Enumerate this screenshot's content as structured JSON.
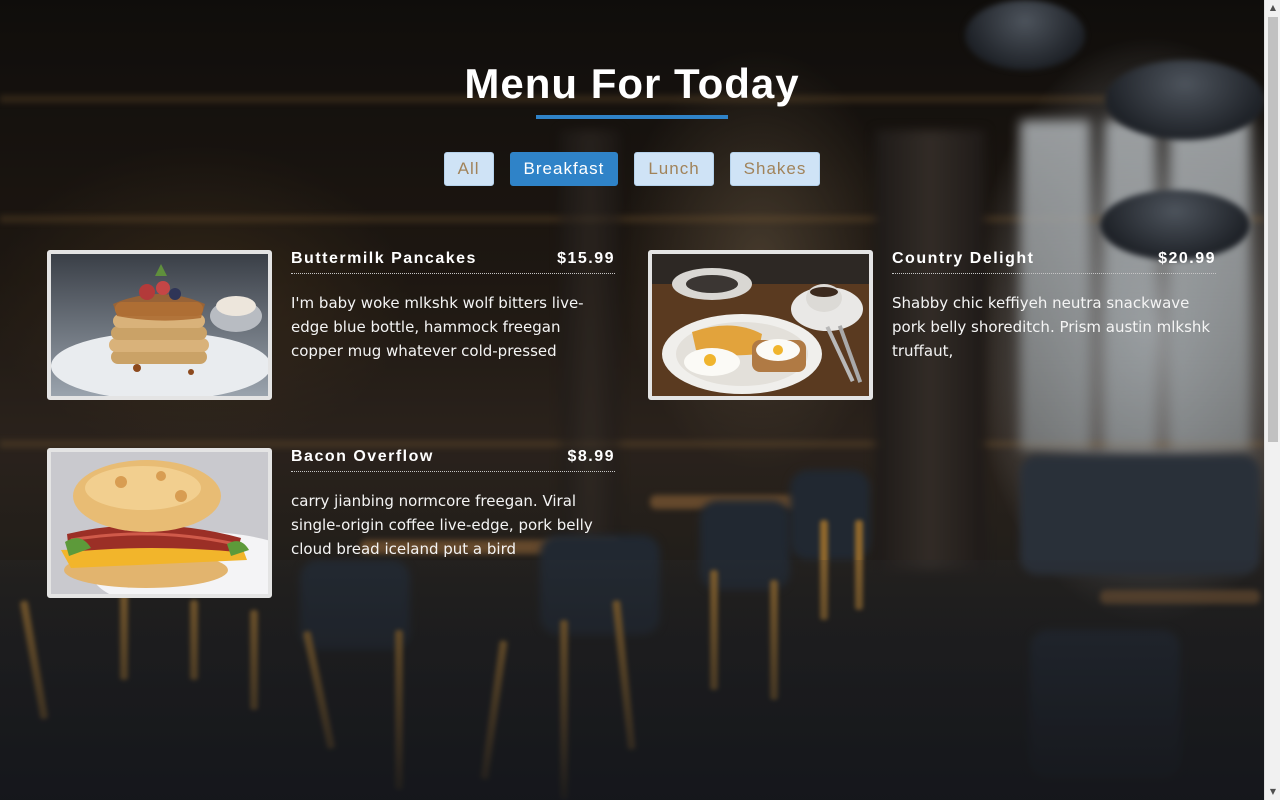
{
  "page": {
    "title": "Menu For Today",
    "accent_color": "#2f83c8"
  },
  "filters": [
    {
      "label": "All",
      "active": false
    },
    {
      "label": "Breakfast",
      "active": true
    },
    {
      "label": "Lunch",
      "active": false
    },
    {
      "label": "Shakes",
      "active": false
    }
  ],
  "menu_items": [
    {
      "name": "Buttermilk Pancakes",
      "price": "$15.99",
      "description": "I'm baby woke mlkshk wolf bitters live-edge blue bottle, hammock freegan copper mug whatever cold-pressed",
      "image": "pancakes-photo"
    },
    {
      "name": "Country Delight",
      "price": "$20.99",
      "description": "Shabby chic keffiyeh neutra snackwave pork belly shoreditch. Prism austin mlkshk truffaut,",
      "image": "eggs-toast-photo"
    },
    {
      "name": "Bacon Overflow",
      "price": "$8.99",
      "description": "carry jianbing normcore freegan. Viral single-origin coffee live-edge, pork belly cloud bread iceland put a bird",
      "image": "bacon-biscuit-photo"
    }
  ]
}
